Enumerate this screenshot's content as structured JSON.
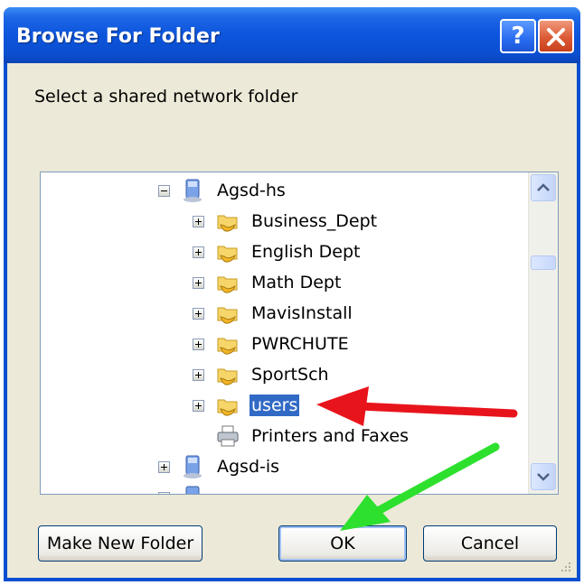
{
  "window": {
    "title": "Browse For Folder",
    "help_glyph": "?",
    "close_glyph": "x"
  },
  "dialog": {
    "prompt": "Select a shared network folder"
  },
  "tree": {
    "items": [
      {
        "label": "Agsd-hs",
        "expander": "minus",
        "icon": "computer-icon",
        "level": 0
      },
      {
        "label": "Business_Dept",
        "expander": "plus",
        "icon": "shared-folder-icon",
        "level": 1
      },
      {
        "label": "English Dept",
        "expander": "plus",
        "icon": "shared-folder-icon",
        "level": 1
      },
      {
        "label": "Math Dept",
        "expander": "plus",
        "icon": "shared-folder-icon",
        "level": 1
      },
      {
        "label": "MavisInstall",
        "expander": "plus",
        "icon": "shared-folder-icon",
        "level": 1
      },
      {
        "label": "PWRCHUTE",
        "expander": "plus",
        "icon": "shared-folder-icon",
        "level": 1
      },
      {
        "label": "SportSch",
        "expander": "plus",
        "icon": "shared-folder-icon",
        "level": 1
      },
      {
        "label": "users",
        "expander": "plus",
        "icon": "shared-folder-icon",
        "level": 1,
        "selected": true
      },
      {
        "label": "Printers and Faxes",
        "expander": "none",
        "icon": "printer-icon",
        "level": 1
      },
      {
        "label": "Agsd-is",
        "expander": "plus",
        "icon": "computer-icon",
        "level": 0
      }
    ]
  },
  "buttons": {
    "make_new_folder": "Make New Folder",
    "ok": "OK",
    "cancel": "Cancel"
  },
  "colors": {
    "title_bar": "#0b4ecf",
    "selection": "#316ac5",
    "annotation_red": "#e8141c",
    "annotation_green": "#2ee02e"
  }
}
